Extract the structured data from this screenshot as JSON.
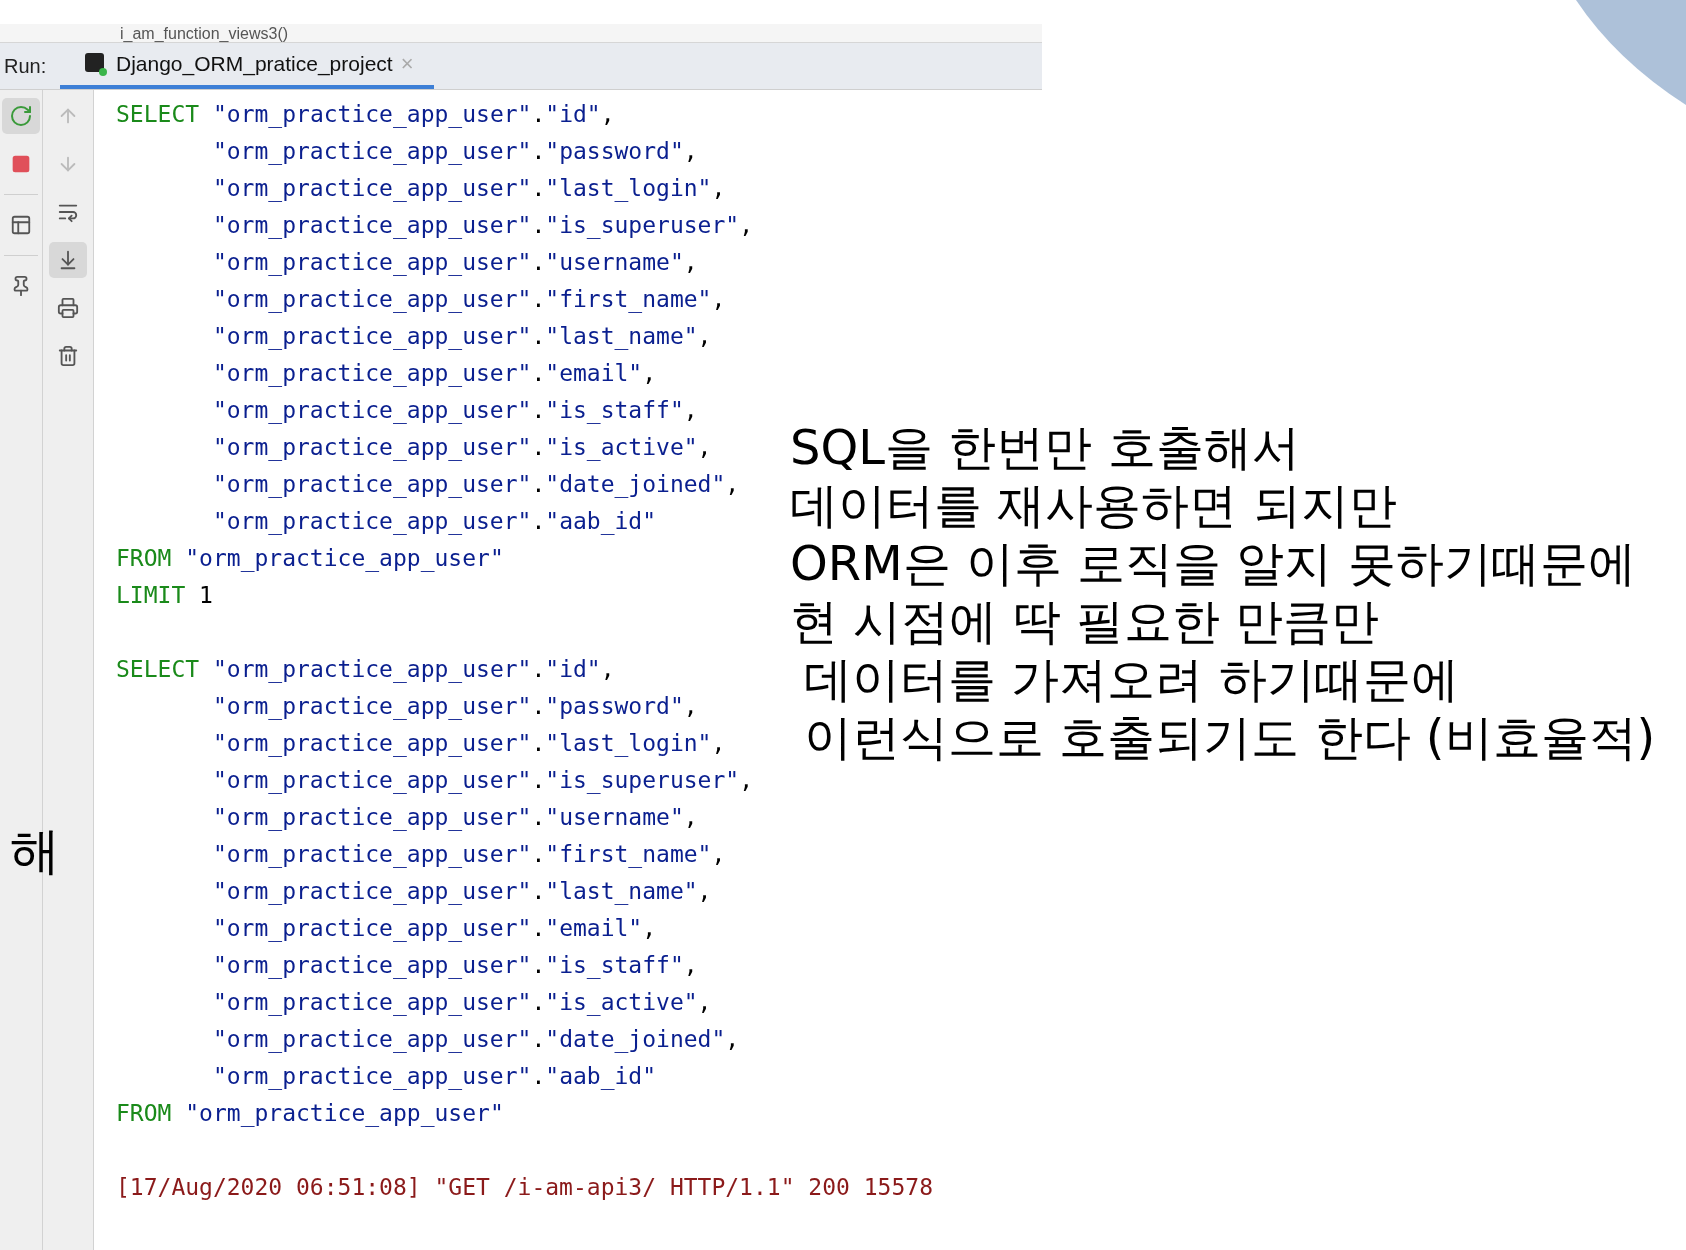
{
  "editor_peek": {
    "text": "i_am_function_views3()"
  },
  "run_panel": {
    "label": "Run:",
    "tabs": [
      {
        "title": "Django_ORM_pratice_project",
        "close": "×",
        "selected": true
      }
    ],
    "left_tools": [
      {
        "kind": "rerun",
        "active": true
      },
      {
        "kind": "stop",
        "active": false
      },
      {
        "kind": "divider"
      },
      {
        "kind": "layout",
        "active": false
      },
      {
        "kind": "divider"
      },
      {
        "kind": "pin",
        "active": false
      }
    ],
    "right_tools": [
      {
        "kind": "up",
        "active": false
      },
      {
        "kind": "down",
        "active": false
      },
      {
        "kind": "wrap",
        "active": false
      },
      {
        "kind": "scroll_end",
        "active": true
      },
      {
        "kind": "print",
        "active": false
      },
      {
        "kind": "trash",
        "active": false
      }
    ],
    "console_lines": [
      {
        "kind": "keyword",
        "keyword": "SELECT",
        "text": "\"orm_practice_app_user\".\"id\","
      },
      {
        "kind": "continued",
        "text": "\"orm_practice_app_user\".\"password\","
      },
      {
        "kind": "continued",
        "text": "\"orm_practice_app_user\".\"last_login\","
      },
      {
        "kind": "continued",
        "text": "\"orm_practice_app_user\".\"is_superuser\","
      },
      {
        "kind": "continued",
        "text": "\"orm_practice_app_user\".\"username\","
      },
      {
        "kind": "continued",
        "text": "\"orm_practice_app_user\".\"first_name\","
      },
      {
        "kind": "continued",
        "text": "\"orm_practice_app_user\".\"last_name\","
      },
      {
        "kind": "continued",
        "text": "\"orm_practice_app_user\".\"email\","
      },
      {
        "kind": "continued",
        "text": "\"orm_practice_app_user\".\"is_staff\","
      },
      {
        "kind": "continued",
        "text": "\"orm_practice_app_user\".\"is_active\","
      },
      {
        "kind": "continued",
        "text": "\"orm_practice_app_user\".\"date_joined\","
      },
      {
        "kind": "continued",
        "text": "\"orm_practice_app_user\".\"aab_id\""
      },
      {
        "kind": "keyword",
        "keyword": "FROM",
        "text": "\"orm_practice_app_user\""
      },
      {
        "kind": "keyword",
        "keyword": "LIMIT",
        "text": "1"
      },
      {
        "kind": "blank"
      },
      {
        "kind": "keyword",
        "keyword": "SELECT",
        "text": "\"orm_practice_app_user\".\"id\","
      },
      {
        "kind": "continued",
        "text": "\"orm_practice_app_user\".\"password\","
      },
      {
        "kind": "continued",
        "text": "\"orm_practice_app_user\".\"last_login\","
      },
      {
        "kind": "continued",
        "text": "\"orm_practice_app_user\".\"is_superuser\","
      },
      {
        "kind": "continued",
        "text": "\"orm_practice_app_user\".\"username\","
      },
      {
        "kind": "continued",
        "text": "\"orm_practice_app_user\".\"first_name\","
      },
      {
        "kind": "continued",
        "text": "\"orm_practice_app_user\".\"last_name\","
      },
      {
        "kind": "continued",
        "text": "\"orm_practice_app_user\".\"email\","
      },
      {
        "kind": "continued",
        "text": "\"orm_practice_app_user\".\"is_staff\","
      },
      {
        "kind": "continued",
        "text": "\"orm_practice_app_user\".\"is_active\","
      },
      {
        "kind": "continued",
        "text": "\"orm_practice_app_user\".\"date_joined\","
      },
      {
        "kind": "continued",
        "text": "\"orm_practice_app_user\".\"aab_id\""
      },
      {
        "kind": "keyword",
        "keyword": "FROM",
        "text": "\"orm_practice_app_user\""
      },
      {
        "kind": "blank"
      },
      {
        "kind": "log",
        "text": "[17/Aug/2020 06:51:08] \"GET /i-am-api3/ HTTP/1.1\" 200 15578"
      }
    ]
  },
  "side_char": {
    "text": "해"
  },
  "annotation": [
    {
      "text": "SQL을 한번만 호출해서",
      "indented": false
    },
    {
      "text": "데이터를 재사용하면 되지만",
      "indented": false
    },
    {
      "text": "ORM은 이후 로직을 알지 못하기때문에",
      "indented": false
    },
    {
      "text": "현 시점에 딱 필요한 만큼만",
      "indented": false
    },
    {
      "text": "데이터를 가져오려 하기때문에",
      "indented": true
    },
    {
      "text": "이런식으로 호출되기도 한다 (비효율적)",
      "indented": true
    }
  ]
}
